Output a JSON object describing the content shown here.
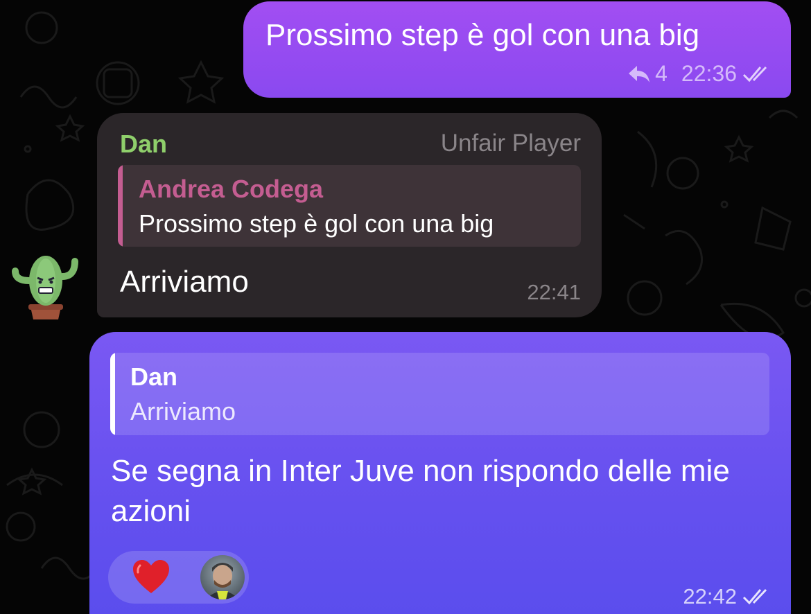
{
  "colors": {
    "outgoing_bubble": "#8a49f0",
    "outgoing_bubble_2": "#6450ef",
    "incoming_bubble": "#2b2629",
    "sender_name": "#8fcf6b",
    "quoted_name": "#c45d91",
    "heart": "#e0202a"
  },
  "messages": {
    "first_outgoing": {
      "text": "Prossimo step è gol con una big",
      "reply_count": "4",
      "time": "22:36",
      "status_icon": "double-check-icon",
      "reply_icon": "reply-arrow-icon"
    },
    "incoming": {
      "sender": "Dan",
      "sender_tag": "Unfair Player",
      "quote": {
        "name": "Andrea Codega",
        "text": "Prossimo step è gol con una big"
      },
      "text": "Arriviamo",
      "time": "22:41",
      "avatar_icon": "cactus-sticker-avatar"
    },
    "second_outgoing": {
      "quote": {
        "name": "Dan",
        "text": "Arriviamo"
      },
      "text": "Se segna in Inter Juve non rispondo delle mie azioni",
      "time": "22:42",
      "status_icon": "double-check-icon",
      "reaction": {
        "emoji_icon": "red-heart-icon",
        "reactor_icon": "user-avatar"
      }
    }
  }
}
